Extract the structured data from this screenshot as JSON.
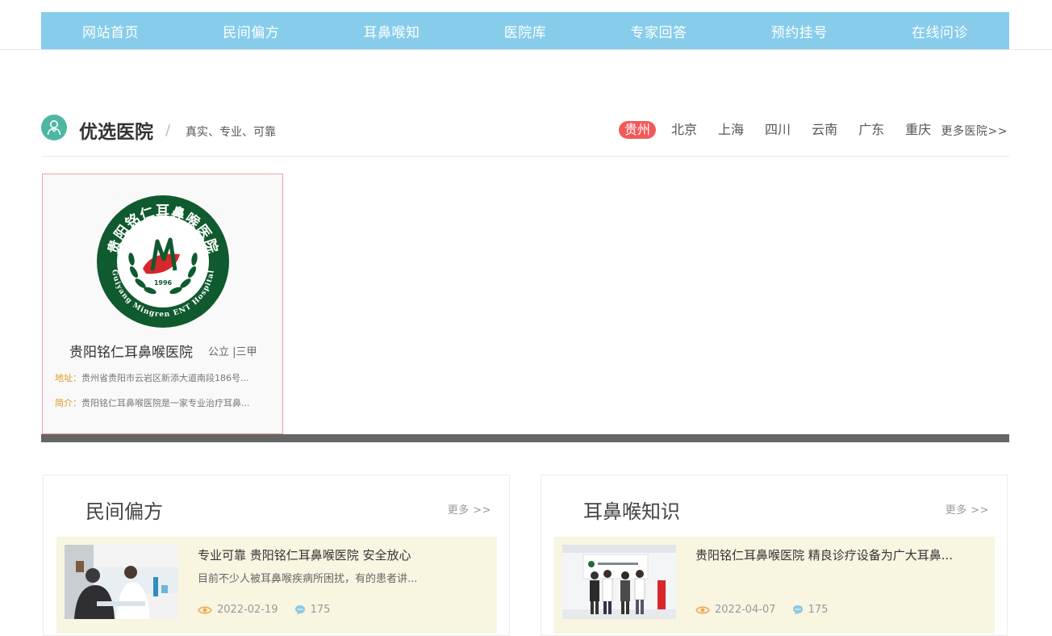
{
  "nav": {
    "items": [
      "网站首页",
      "民间偏方",
      "耳鼻喉知",
      "医院库",
      "专家回答",
      "预约挂号",
      "在线问诊"
    ]
  },
  "section": {
    "title": "优选医院",
    "slash": "/",
    "subtitle": "真实、专业、可靠",
    "cities": [
      "贵州",
      "北京",
      "上海",
      "四川",
      "云南",
      "广东",
      "重庆"
    ],
    "active_city": "贵州",
    "more": "更多医院>>"
  },
  "hospital": {
    "name": "贵阳铭仁耳鼻喉医院",
    "type": "公立 |三甲",
    "address_label": "地址：",
    "address": "贵州省贵阳市云岩区新添大道南段186号...",
    "intro_label": "简介：",
    "intro": "贵阳铭仁耳鼻喉医院是一家专业治疗耳鼻...",
    "logo_year": "1996",
    "logo_top_text": "贵阳铭仁耳鼻喉医院",
    "logo_bottom_text": "Guiyang Mingren ENT Hospital"
  },
  "panels": [
    {
      "title": "民间偏方",
      "more": "更多 >>",
      "news": {
        "title": "专业可靠 贵阳铭仁耳鼻喉医院 安全放心",
        "desc": "目前不少人被耳鼻喉疾病所困扰，有的患者讲...",
        "date": "2022-02-19",
        "comments": "175"
      }
    },
    {
      "title": "耳鼻喉知识",
      "more": "更多 >>",
      "news": {
        "title": "贵阳铭仁耳鼻喉医院 精良诊疗设备为广大耳鼻...",
        "desc": "",
        "date": "2022-04-07",
        "comments": "175"
      }
    }
  ],
  "colors": {
    "nav_bg": "#87cdeb",
    "active_city_bg": "#f25a5a",
    "logo_green": "#0f5a2e",
    "logo_red": "#d8262a",
    "news_bg": "#f8f5e1",
    "label_orange": "#e0992c"
  }
}
